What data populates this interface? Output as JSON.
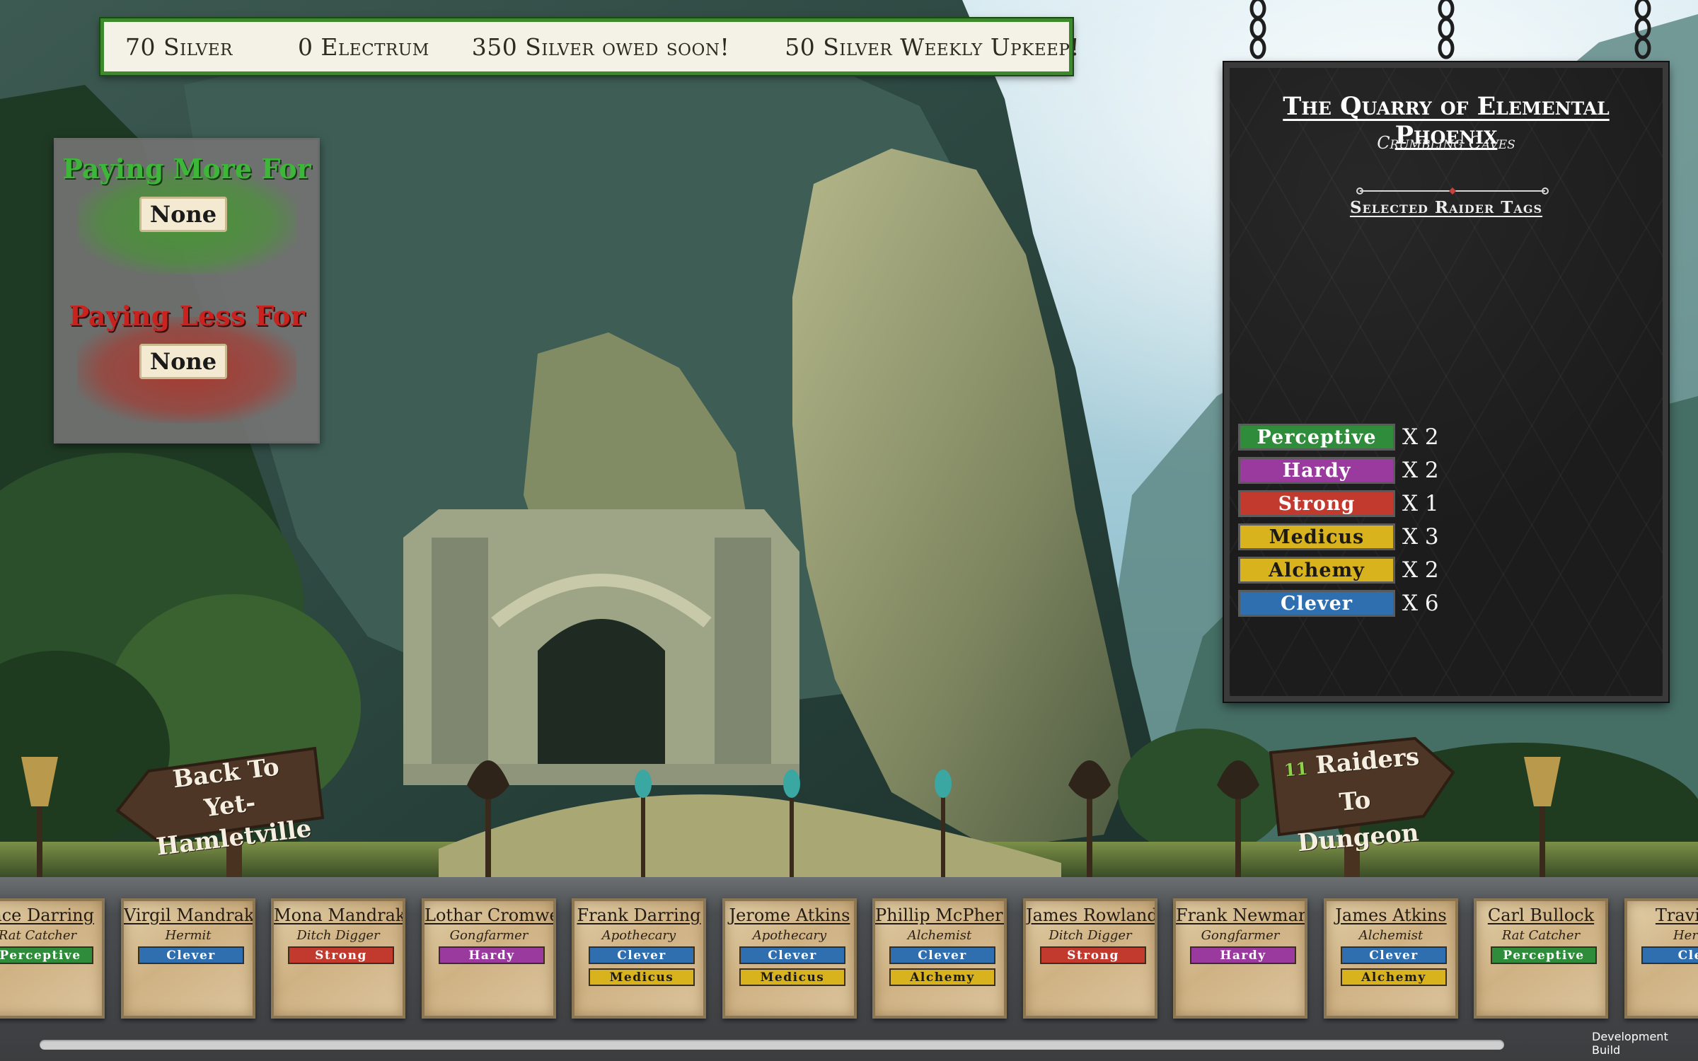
{
  "resources": {
    "silver": "70 Silver",
    "electrum": "0 Electrum",
    "owed": "350 Silver owed soon!",
    "upkeep": "50 Silver Weekly Upkeep!"
  },
  "paying_panel": {
    "more_heading": "Paying More For",
    "more_value": "None",
    "less_heading": "Paying Less For",
    "less_value": "None"
  },
  "dungeon": {
    "title": "The Quarry of Elemental Phoenix",
    "subtitle": "Crumbling Caves",
    "tags_heading": "Selected Raider Tags",
    "tags": [
      {
        "name": "Perceptive",
        "count": "X 2",
        "color": "#2e8c3a"
      },
      {
        "name": "Hardy",
        "count": "X 2",
        "color": "#9a3a9e"
      },
      {
        "name": "Strong",
        "count": "X 1",
        "color": "#c23a2e"
      },
      {
        "name": "Medicus",
        "count": "X 3",
        "color": "#d9b31e"
      },
      {
        "name": "Alchemy",
        "count": "X 2",
        "color": "#d9b31e"
      },
      {
        "name": "Clever",
        "count": "X 6",
        "color": "#2f6fb0"
      }
    ]
  },
  "navigation": {
    "back_line1": "Back To",
    "back_line2": "Yet-Hamletville",
    "raiders_count": "11",
    "raiders_line1": "Raiders To",
    "raiders_line2": "Dungeon"
  },
  "roster": [
    {
      "name": "ence Darring",
      "job": "Rat Catcher",
      "tags": [
        "Perceptive"
      ]
    },
    {
      "name": "Virgil Mandrake",
      "job": "Hermit",
      "tags": [
        "Clever"
      ]
    },
    {
      "name": "Mona Mandrake",
      "job": "Ditch Digger",
      "tags": [
        "Strong"
      ]
    },
    {
      "name": "Lothar Cromwell",
      "job": "Gongfarmer",
      "tags": [
        "Hardy"
      ]
    },
    {
      "name": "Frank Darring",
      "job": "Apothecary",
      "tags": [
        "Clever",
        "Medicus"
      ]
    },
    {
      "name": "Jerome Atkins",
      "job": "Apothecary",
      "tags": [
        "Clever",
        "Medicus"
      ]
    },
    {
      "name": "Phillip McPherson",
      "job": "Alchemist",
      "tags": [
        "Clever",
        "Alchemy"
      ]
    },
    {
      "name": "James Rowland",
      "job": "Ditch Digger",
      "tags": [
        "Strong"
      ]
    },
    {
      "name": "Frank Newman",
      "job": "Gongfarmer",
      "tags": [
        "Hardy"
      ]
    },
    {
      "name": "James Atkins",
      "job": "Alchemist",
      "tags": [
        "Clever",
        "Alchemy"
      ]
    },
    {
      "name": "Carl Bullock",
      "job": "Rat Catcher",
      "tags": [
        "Perceptive"
      ]
    },
    {
      "name": "Travis D",
      "job": "Herm",
      "tags": [
        "Clev"
      ]
    }
  ],
  "tag_colors": {
    "Perceptive": "#2e8c3a",
    "Hardy": "#9a3a9e",
    "Strong": "#c23a2e",
    "Medicus": "#d9b31e",
    "Alchemy": "#d9b31e",
    "Clever": "#2f6fb0",
    "Clev": "#2f6fb0"
  },
  "dev_label": "Development Build"
}
